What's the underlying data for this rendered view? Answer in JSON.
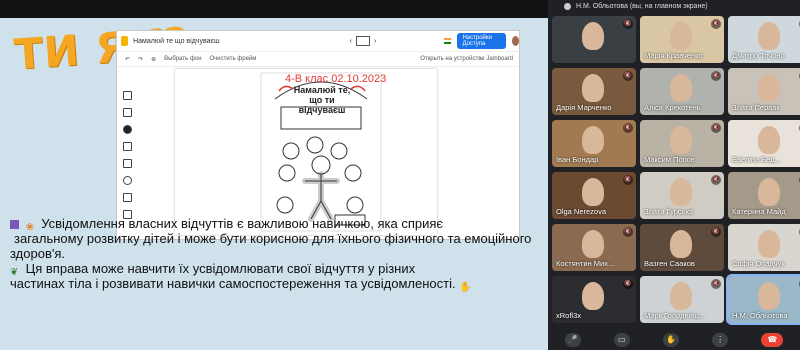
{
  "slide": {
    "title": "ТИ ЯК?"
  },
  "jamboard": {
    "doc_title": "Намалюй те що відчуваєш",
    "share_button": "Настройки Доступа",
    "toolbar": [
      "Выбрать фон",
      "Очистить фрейм"
    ],
    "device_link": "Открыть на устройстве Jamboard",
    "tools": [
      "pen",
      "eraser",
      "select",
      "sticky-note",
      "image",
      "circle",
      "textbox",
      "laser"
    ],
    "stamp": "4-В клас 02.10.2023",
    "sheet_heading": "Намалюй те, що ти відчуваєш"
  },
  "caption": {
    "line1": "Усвідомлення власних відчуттів є важливою навичкою, яка сприяє",
    "line2": "загальному розвитку дітей і може бути корисною для їхнього фізичного та емоційного",
    "line3": "здоров'я.",
    "line4": "Ця вправа може навчити їх усвідомлювати свої відчуття у різних",
    "line5": "частинах тіла і розвивати навички самоспостереження та усвідомленості."
  },
  "meet": {
    "presenter_label": "Н.М. Обльотова (вы, на главном экране)",
    "participants": [
      {
        "name": "",
        "bg": "#3a3f44"
      },
      {
        "name": "Марія Кравченко",
        "bg": "#d8c6a4"
      },
      {
        "name": "Дмитро Точоно",
        "bg": "#cfd8dc"
      },
      {
        "name": "Дарія Марченко",
        "bg": "#7a5a3e"
      },
      {
        "name": "Аліса Крекотень",
        "bg": "#b0b3ad"
      },
      {
        "name": "Злата Первак",
        "bg": "#c9c2b8"
      },
      {
        "name": "Іван Бондар",
        "bg": "#a27a52"
      },
      {
        "name": "Максим Попов",
        "bg": "#b9b3a5"
      },
      {
        "name": "Евеліна Бед...",
        "bg": "#e8e2da"
      },
      {
        "name": "Olga Nerezova",
        "bg": "#6c4a32"
      },
      {
        "name": "Злата Гурська",
        "bg": "#d1ccc3"
      },
      {
        "name": "Катерина Майд",
        "bg": "#a59a8a"
      },
      {
        "name": "Костянтин Мих...",
        "bg": "#8a6b52"
      },
      {
        "name": "Вазген Сааков",
        "bg": "#5e4b3c"
      },
      {
        "name": "Софія Осадчук",
        "bg": "#d9d6cf"
      },
      {
        "name": "xRofl3x",
        "bg": "#2b2d30"
      },
      {
        "name": "Марк Голоднищ...",
        "bg": "#cfd2d4"
      },
      {
        "name": "Н.М. Обльотова",
        "bg": "#9ab8c8"
      }
    ]
  }
}
